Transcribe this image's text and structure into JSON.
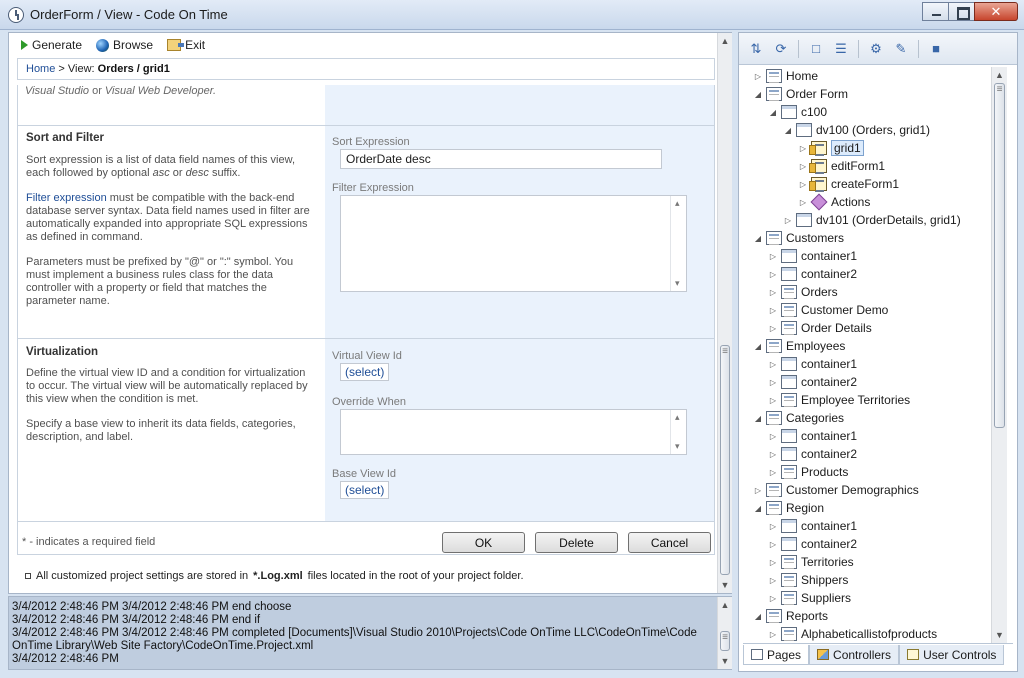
{
  "window": {
    "title": "OrderForm / View - Code On Time"
  },
  "toolbar": {
    "generate": "Generate",
    "browse": "Browse",
    "exit": "Exit"
  },
  "breadcrumb": {
    "home": "Home",
    "separator": ">",
    "view_prefix": "View:",
    "current": "Orders / grid1"
  },
  "content": {
    "top_fragment": {
      "text1": "Visual Studio",
      "text2": "or",
      "text3": "Visual Web Developer."
    },
    "sort_filter": {
      "title": "Sort and Filter",
      "p1_a": "Sort expression is a list of data field names of this view, each followed by optional",
      "p1_asc": "asc",
      "p1_or": "or",
      "p1_desc": "desc",
      "p1_b": "suffix.",
      "p2_link": "Filter expression",
      "p2_rest": "must be compatible with the back-end database server syntax. Data field names used in filter are automatically expanded into appropriate SQL expressions as defined in command.",
      "p3": "Parameters must be prefixed by \"@\" or \":\" symbol. You must implement a business rules class for the data controller with a property or field that matches the parameter name.",
      "sort_label": "Sort Expression",
      "sort_value": "OrderDate desc",
      "filter_label": "Filter Expression",
      "filter_value": ""
    },
    "virtualization": {
      "title": "Virtualization",
      "p1": "Define the virtual view ID and a condition for virtualization to occur. The virtual view will be automatically replaced by this view when the condition is met.",
      "p2": "Specify a base view to inherit its data fields, categories, description, and label.",
      "virtual_view_label": "Virtual View Id",
      "virtual_view_link": "(select)",
      "override_label": "Override When",
      "override_value": "",
      "base_view_label": "Base View Id",
      "base_view_link": "(select)"
    },
    "required_note": "* - indicates a required field",
    "buttons": {
      "ok": "OK",
      "delete": "Delete",
      "cancel": "Cancel"
    },
    "footnote": {
      "a": "All customized project settings are stored in",
      "b": "*.Log.xml",
      "c": "files located in the root of your project folder."
    }
  },
  "log": {
    "text": "3/4/2012 2:48:46 PM 3/4/2012 2:48:46 PM end choose\n3/4/2012 2:48:46 PM 3/4/2012 2:48:46 PM end if\n3/4/2012 2:48:46 PM 3/4/2012 2:48:46 PM completed [Documents]\\Visual Studio 2010\\Projects\\Code OnTime LLC\\CodeOnTime\\Code OnTime Library\\Web Site Factory\\CodeOnTime.Project.xml\n3/4/2012 2:48:46 PM"
  },
  "tree": {
    "items": [
      {
        "label": "Home",
        "level": 0,
        "icon": "page-icon",
        "state": "collapsed"
      },
      {
        "label": "Order Form",
        "level": 0,
        "icon": "page-icon",
        "state": "expanded"
      },
      {
        "label": "c100",
        "level": 1,
        "icon": "container-icon",
        "state": "expanded"
      },
      {
        "label": "dv100 (Orders, grid1)",
        "level": 2,
        "icon": "container-icon",
        "state": "expanded"
      },
      {
        "label": "grid1",
        "level": 3,
        "icon": "view-icon",
        "state": "collapsed",
        "selected": true
      },
      {
        "label": "editForm1",
        "level": 3,
        "icon": "view-icon",
        "state": "collapsed"
      },
      {
        "label": "createForm1",
        "level": 3,
        "icon": "view-icon",
        "state": "collapsed"
      },
      {
        "label": "Actions",
        "level": 3,
        "icon": "actions-icon",
        "state": "collapsed"
      },
      {
        "label": "dv101 (OrderDetails, grid1)",
        "level": 2,
        "icon": "container-icon",
        "state": "collapsed"
      },
      {
        "label": "Customers",
        "level": 0,
        "icon": "page-icon",
        "state": "expanded"
      },
      {
        "label": "container1",
        "level": 1,
        "icon": "container-icon",
        "state": "collapsed"
      },
      {
        "label": "container2",
        "level": 1,
        "icon": "container-icon",
        "state": "collapsed"
      },
      {
        "label": "Orders",
        "level": 1,
        "icon": "page-icon",
        "state": "collapsed"
      },
      {
        "label": "Customer Demo",
        "level": 1,
        "icon": "page-icon",
        "state": "collapsed"
      },
      {
        "label": "Order Details",
        "level": 1,
        "icon": "page-icon",
        "state": "collapsed"
      },
      {
        "label": "Employees",
        "level": 0,
        "icon": "page-icon",
        "state": "expanded"
      },
      {
        "label": "container1",
        "level": 1,
        "icon": "container-icon",
        "state": "collapsed"
      },
      {
        "label": "container2",
        "level": 1,
        "icon": "container-icon",
        "state": "collapsed"
      },
      {
        "label": "Employee Territories",
        "level": 1,
        "icon": "page-icon",
        "state": "collapsed"
      },
      {
        "label": "Categories",
        "level": 0,
        "icon": "page-icon",
        "state": "expanded"
      },
      {
        "label": "container1",
        "level": 1,
        "icon": "container-icon",
        "state": "collapsed"
      },
      {
        "label": "container2",
        "level": 1,
        "icon": "container-icon",
        "state": "collapsed"
      },
      {
        "label": "Products",
        "level": 1,
        "icon": "page-icon",
        "state": "collapsed"
      },
      {
        "label": "Customer Demographics",
        "level": 0,
        "icon": "page-icon",
        "state": "collapsed"
      },
      {
        "label": "Region",
        "level": 0,
        "icon": "page-icon",
        "state": "expanded"
      },
      {
        "label": "container1",
        "level": 1,
        "icon": "container-icon",
        "state": "collapsed"
      },
      {
        "label": "container2",
        "level": 1,
        "icon": "container-icon",
        "state": "collapsed"
      },
      {
        "label": "Territories",
        "level": 1,
        "icon": "page-icon",
        "state": "collapsed"
      },
      {
        "label": "Shippers",
        "level": 1,
        "icon": "page-icon",
        "state": "collapsed"
      },
      {
        "label": "Suppliers",
        "level": 1,
        "icon": "page-icon",
        "state": "collapsed"
      },
      {
        "label": "Reports",
        "level": 0,
        "icon": "page-icon",
        "state": "expanded"
      },
      {
        "label": "Alphabeticallistofproducts",
        "level": 1,
        "icon": "page-icon",
        "state": "collapsed"
      }
    ]
  },
  "tabs": [
    {
      "label": "Pages",
      "icon": "pages-icon",
      "active": true
    },
    {
      "label": "Controllers",
      "icon": "controllers-icon",
      "active": false
    },
    {
      "label": "User Controls",
      "icon": "user-controls-icon",
      "active": false
    }
  ]
}
